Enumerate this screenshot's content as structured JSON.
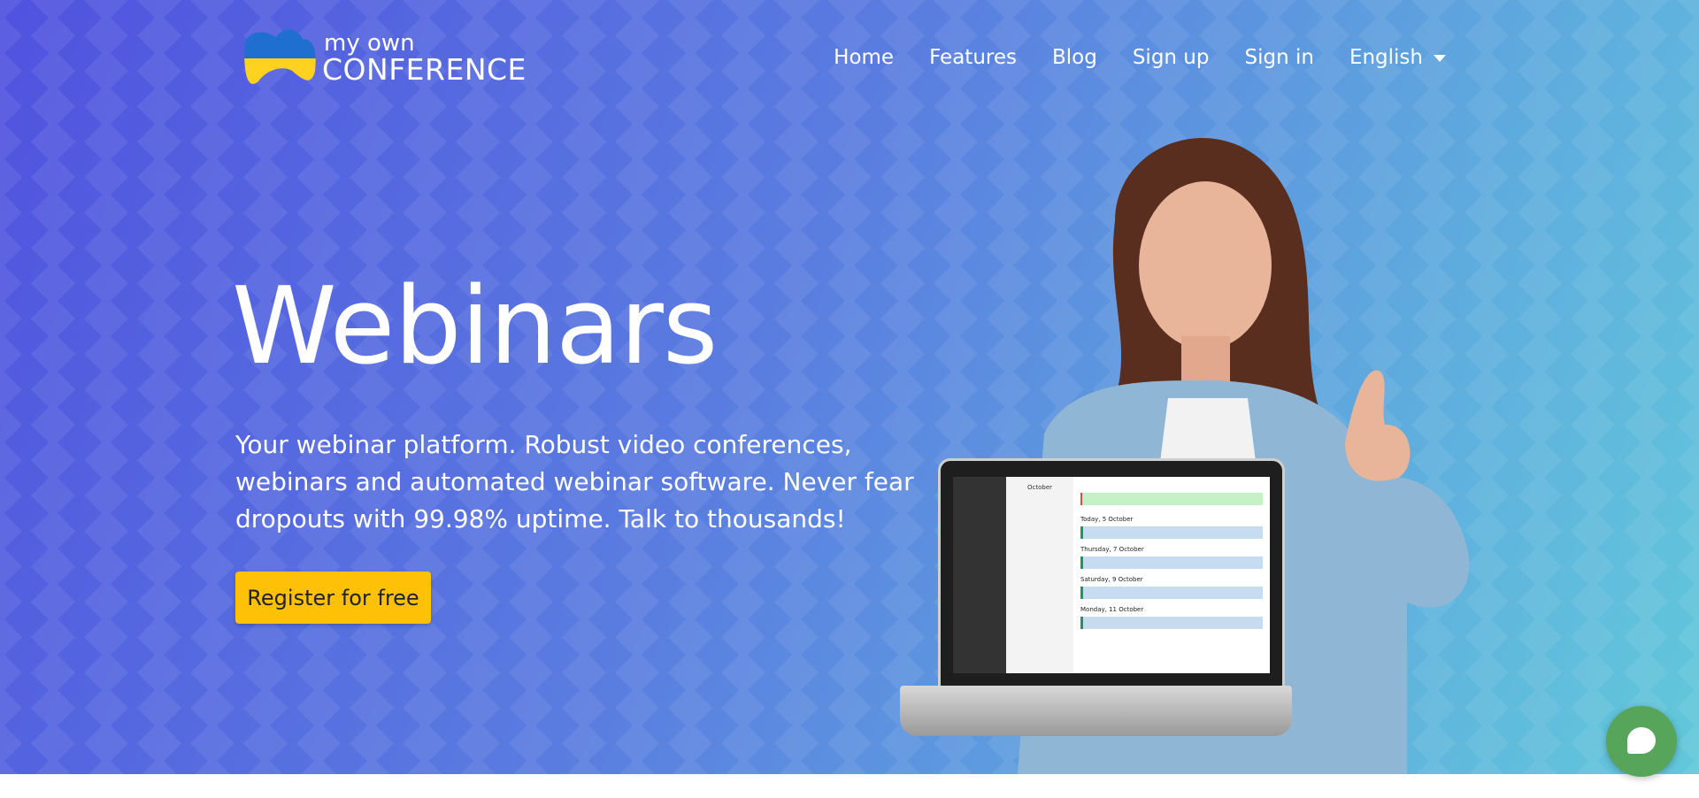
{
  "logo": {
    "line1": "my own",
    "line2": "CONFERENCE"
  },
  "nav": {
    "items": [
      "Home",
      "Features",
      "Blog",
      "Sign up",
      "Sign in"
    ],
    "language": "English"
  },
  "hero": {
    "title": "Webinars",
    "description": "Your webinar platform. Robust video conferences, webinars and automated webinar software. Never fear dropouts with 99.98% uptime. Talk to thousands!",
    "cta": "Register for free"
  },
  "laptop_screen": {
    "month": "October",
    "days": [
      "Today, 5 October",
      "Thursday, 7 October",
      "Saturday, 9 October",
      "Monday, 11 October"
    ]
  },
  "colors": {
    "cta": "#ffc107",
    "chat": "#57a55a",
    "gradient_start": "#5052df",
    "gradient_end": "#62c8da"
  }
}
